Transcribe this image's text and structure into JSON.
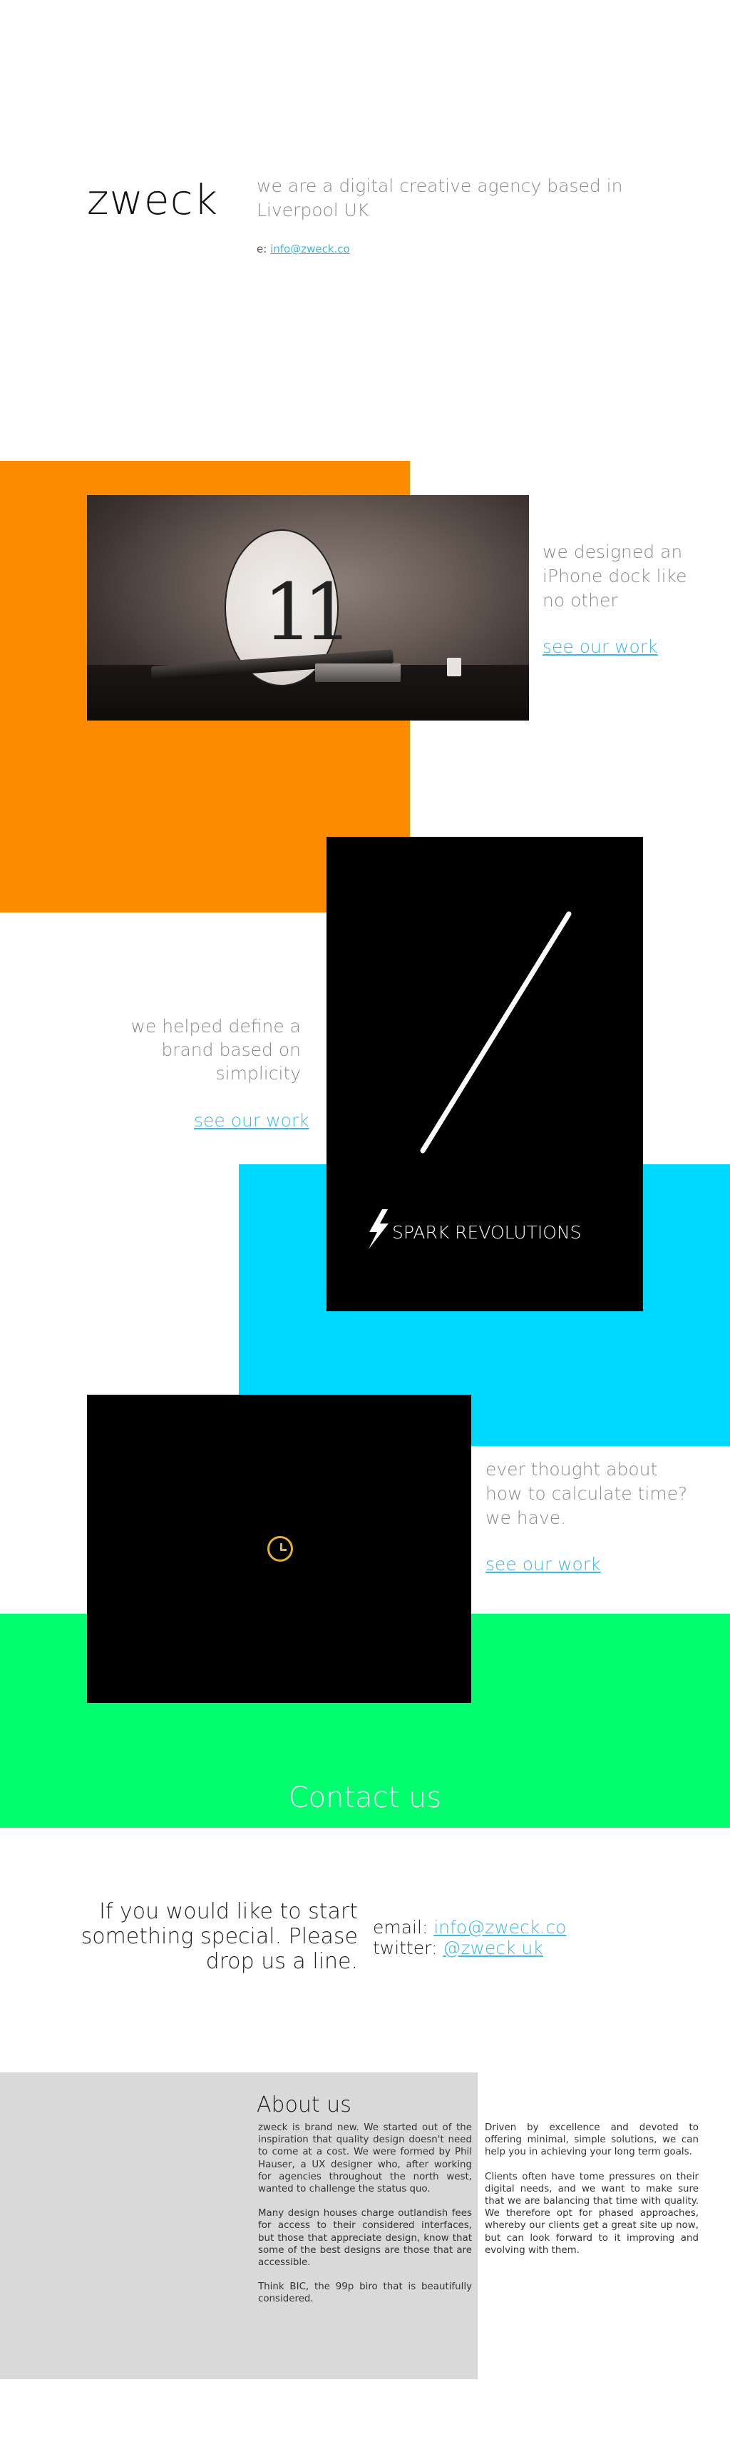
{
  "header": {
    "logo": "zweck",
    "tagline": "we are a digital creative agency based in Liverpool UK",
    "email_prefix": "e: ",
    "email_link": "info@zweck.co"
  },
  "projects": {
    "dock": {
      "image_text": "11",
      "description": "we designed an iPhone dock like no other",
      "link": "see our work"
    },
    "spark": {
      "brand_name": "SPARK REVOLUTIONS",
      "description": "we helped define a brand based on simplicity",
      "link": "see our work"
    },
    "time": {
      "description": "ever thought about how to calculate time? we have.",
      "link": "see our work"
    }
  },
  "contact": {
    "heading": "Contact us",
    "pitch": "If you would like to start something special. Please drop us a line.",
    "email_label": "email: ",
    "email_value": "info@zweck.co",
    "twitter_label": "twitter: ",
    "twitter_value": "@zweck uk"
  },
  "about": {
    "title": "About us",
    "left_p1": "zweck is brand new. We started out of the inspiration that quality design doesn't need to come at a cost. We were formed by Phil Hauser, a UX designer who, after working for agencies throughout the north west, wanted to challenge the status quo.",
    "left_p2": "Many design houses charge outlandish fees for access to their considered interfaces, but those that appreciate design, know that some of the best designs are those that are accessible.",
    "left_p3": "Think BIC, the 99p biro that is beautifully considered.",
    "right_p1": "Driven by excellence and devoted to offering minimal, simple solutions, we can help you in achieving your long term goals.",
    "right_p2": "Clients often have tome pressures on their digital needs, and we want to make sure that we are balancing that time with quality. We therefore opt for phased approaches, whereby our clients get a great site up now, but can look forward to it improving and evolving with them."
  },
  "colors": {
    "orange": "#ff8c00",
    "cyan": "#00d8ff",
    "green": "#00ff6e",
    "link": "#3cb7e6",
    "grey": "#d9d9d9",
    "clock": "#e2b233"
  },
  "icons": [
    "lightning-bolt-icon",
    "clock-icon"
  ]
}
